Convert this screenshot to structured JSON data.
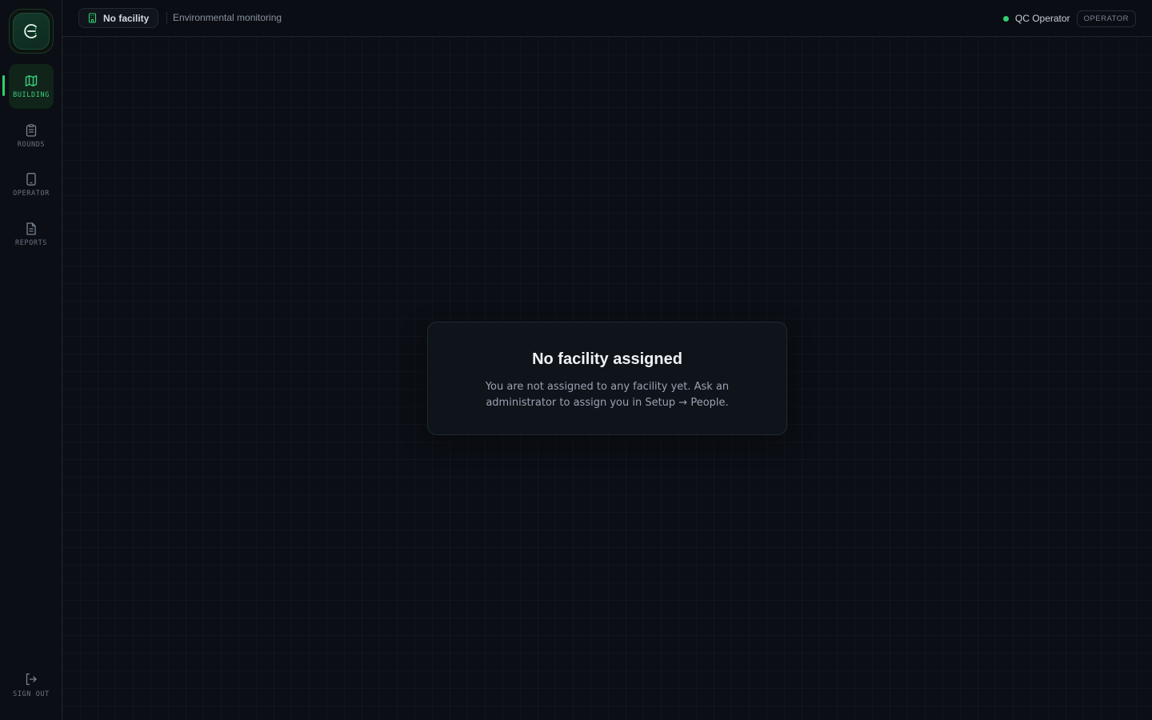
{
  "brand": {
    "logo_letter": "E",
    "accent": "#2fd16f"
  },
  "sidebar": {
    "items": [
      {
        "label": "BUILDING",
        "icon": "map-icon",
        "active": true
      },
      {
        "label": "ROUNDS",
        "icon": "clipboard-icon",
        "active": false
      },
      {
        "label": "OPERATOR",
        "icon": "tablet-icon",
        "active": false
      },
      {
        "label": "REPORTS",
        "icon": "document-icon",
        "active": false
      }
    ],
    "signout_label": "SIGN OUT"
  },
  "header": {
    "facility_label": "No facility",
    "subtitle": "Environmental monitoring",
    "user_name": "QC Operator",
    "role": "OPERATOR",
    "status_color": "#2fd16f"
  },
  "empty_state": {
    "title": "No facility assigned",
    "message": "You are not assigned to any facility yet. Ask an administrator to assign you in Setup → People."
  }
}
